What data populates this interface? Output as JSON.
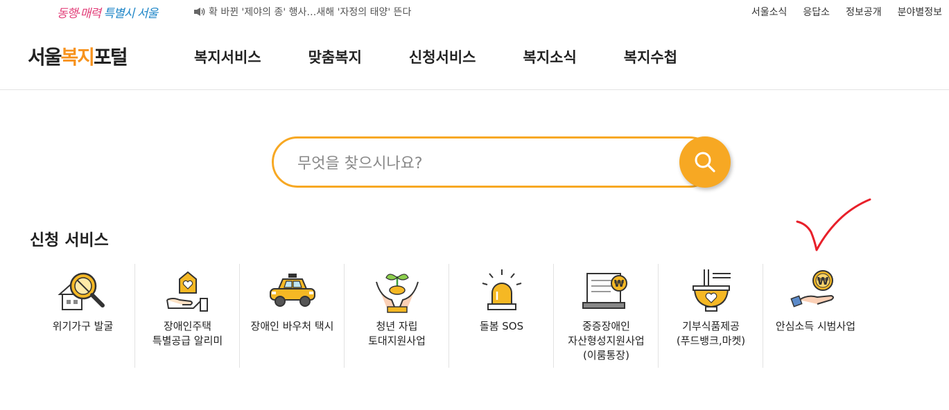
{
  "topbar": {
    "slogan_part1": "동행·매력",
    "slogan_part2": "특별시 서울",
    "notice": "확 바뀐 '제야의 종' 행사…새해 '자정의 태양' 뜬다",
    "util_links": [
      "서울소식",
      "응답소",
      "정보공개",
      "분야별정보"
    ]
  },
  "header": {
    "logo_part1": "서울",
    "logo_part2": "복지",
    "logo_part3": "포털",
    "nav": [
      "복지서비스",
      "맞춤복지",
      "신청서비스",
      "복지소식",
      "복지수첩"
    ]
  },
  "search": {
    "placeholder": "무엇을 찾으시나요?",
    "value": ""
  },
  "section": {
    "title": "신청 서비스"
  },
  "services": [
    {
      "label": "위기가구 발굴",
      "icon": "magnifier-house-icon"
    },
    {
      "label": "장애인주택\n특별공급 알리미",
      "icon": "hand-house-heart-icon"
    },
    {
      "label": "장애인 바우처 택시",
      "icon": "taxi-icon"
    },
    {
      "label": "청년 자립\n토대지원사업",
      "icon": "hands-sprout-icon"
    },
    {
      "label": "돌봄 SOS",
      "icon": "siren-icon"
    },
    {
      "label": "중증장애인\n자산형성지원사업\n(이룸통장)",
      "icon": "bankbook-won-icon"
    },
    {
      "label": "기부식품제공\n(푸드뱅크,마켓)",
      "icon": "bowl-heart-icon"
    },
    {
      "label": "안심소득 시범사업",
      "icon": "hand-won-coin-icon"
    }
  ],
  "colors": {
    "accent": "#f7a823",
    "logo_orange": "#f7931e",
    "logo_red": "#e33c2d",
    "annotation_red": "#e8202a"
  },
  "annotation": {
    "type": "handwritten-checkmark"
  }
}
